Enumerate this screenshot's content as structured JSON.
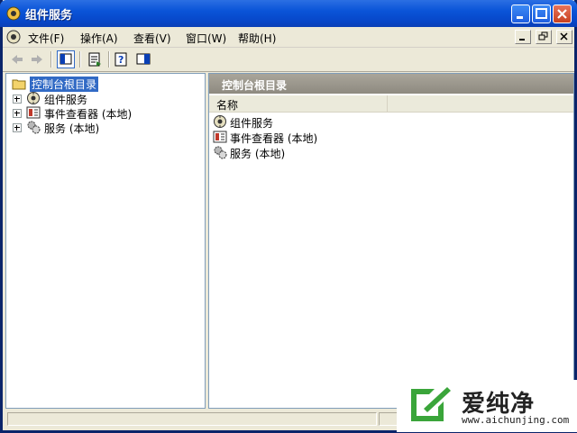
{
  "window": {
    "title": "组件服务"
  },
  "menu": [
    "文件(F)",
    "操作(A)",
    "查看(V)",
    "窗口(W)",
    "帮助(H)"
  ],
  "tree": {
    "root": "控制台根目录",
    "items": [
      {
        "label": "组件服务",
        "icon": "component-services-icon"
      },
      {
        "label": "事件查看器 (本地)",
        "icon": "event-viewer-icon"
      },
      {
        "label": "服务 (本地)",
        "icon": "services-gear-icon"
      }
    ]
  },
  "detail": {
    "header": "控制台根目录",
    "column": "名称",
    "items": [
      {
        "label": "组件服务",
        "icon": "component-services-icon"
      },
      {
        "label": "事件查看器 (本地)",
        "icon": "event-viewer-icon"
      },
      {
        "label": "服务 (本地)",
        "icon": "services-gear-icon"
      }
    ]
  },
  "watermark": {
    "brand": "爱纯净",
    "url": "www.aichunjing.com"
  },
  "colors": {
    "titlebar": "#0a54d8",
    "selection": "#316ac5",
    "pane_header": "#9c988d",
    "watermark_green": "#3aa53a"
  }
}
